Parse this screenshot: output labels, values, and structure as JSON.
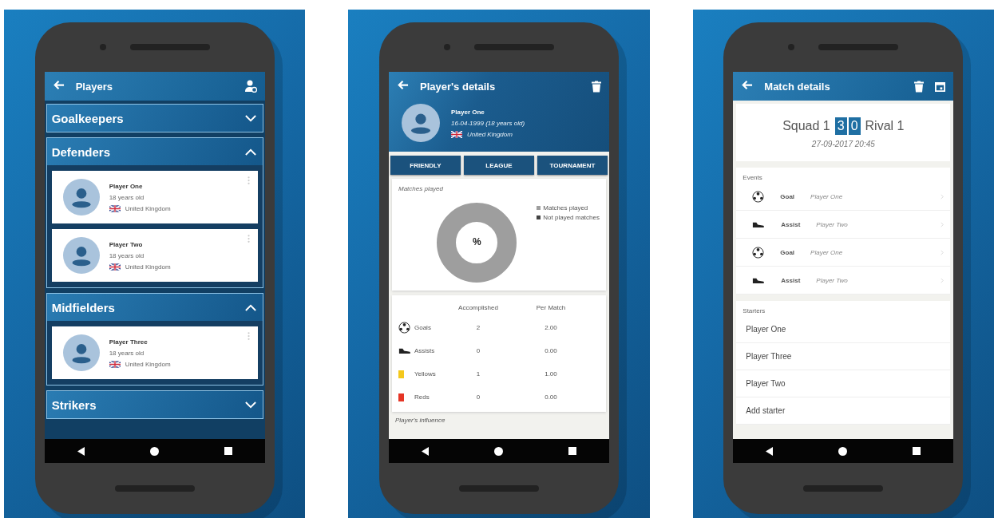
{
  "phones": [
    {
      "kind": "players",
      "title": "Players",
      "groups": [
        {
          "name": "Goalkeepers",
          "expanded": false
        },
        {
          "name": "Defenders",
          "expanded": true,
          "players": [
            {
              "name": "Player One",
              "age": "18 years old",
              "country": "United Kingdom"
            },
            {
              "name": "Player Two",
              "age": "18 years old",
              "country": "United Kingdom"
            }
          ]
        },
        {
          "name": "Midfielders",
          "expanded": true,
          "players": [
            {
              "name": "Player Three",
              "age": "18 years old",
              "country": "United Kingdom"
            }
          ]
        },
        {
          "name": "Strikers",
          "expanded": false
        }
      ]
    },
    {
      "kind": "player_details",
      "title": "Player's details",
      "player": {
        "name": "Player One",
        "birth": "16-04-1999 (18 years old)",
        "country": "United Kingdom"
      },
      "tabs": [
        {
          "label": "FRIENDLY",
          "selected": false
        },
        {
          "label": "LEAGUE",
          "selected": false
        },
        {
          "label": "TOURNAMENT",
          "selected": false
        }
      ],
      "chart": {
        "title": "Matches played",
        "center": "%",
        "legend": [
          {
            "label": "Matches played",
            "color": "#9e9e9e"
          },
          {
            "label": "Not played matches",
            "color": "#424242"
          }
        ]
      },
      "stats": {
        "columns": [
          "Accomplished",
          "Per Match"
        ],
        "rows": [
          {
            "kind": "goal",
            "label": "Goals",
            "value": "2",
            "per_match": "2.00"
          },
          {
            "kind": "assist",
            "label": "Assists",
            "value": "0",
            "per_match": "0.00"
          },
          {
            "kind": "yellow",
            "label": "Yellows",
            "value": "1",
            "per_match": "1.00"
          },
          {
            "kind": "red",
            "label": "Reds",
            "value": "0",
            "per_match": "0.00"
          }
        ]
      },
      "footer": "Player's influence"
    },
    {
      "kind": "match_details",
      "title": "Match details",
      "home": "Squad 1",
      "score": [
        "3",
        "0"
      ],
      "away": "Rival 1",
      "date": "27-09-2017 20:45",
      "events_title": "Events",
      "events": [
        {
          "kind": "goal",
          "type": "Goal",
          "player": "Player One"
        },
        {
          "kind": "assist",
          "type": "Assist",
          "player": "Player Two"
        },
        {
          "kind": "goal",
          "type": "Goal",
          "player": "Player One"
        },
        {
          "kind": "assist",
          "type": "Assist",
          "player": "Player Two"
        }
      ],
      "starters_title": "Starters",
      "starters": [
        "Player One",
        "Player Three",
        "Player Two"
      ],
      "add_starter": "Add starter"
    }
  ]
}
